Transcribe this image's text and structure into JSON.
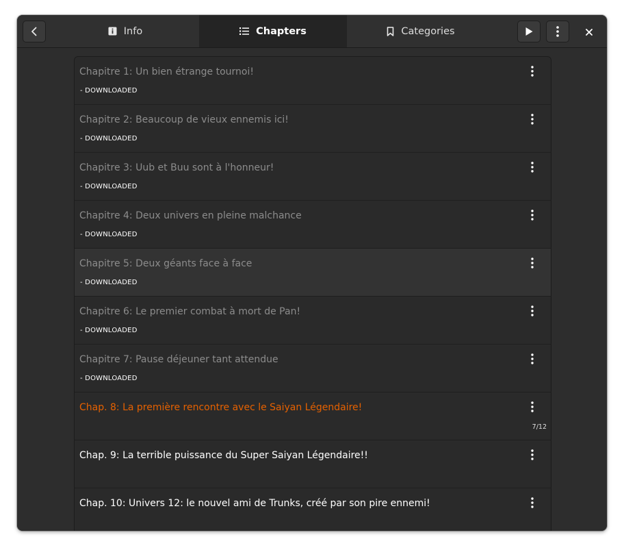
{
  "header": {
    "tabs": [
      {
        "label": "Info",
        "icon": "info-icon",
        "active": false
      },
      {
        "label": "Chapters",
        "icon": "list-icon",
        "active": true
      },
      {
        "label": "Categories",
        "icon": "bookmark-icon",
        "active": false
      }
    ],
    "buttons": [
      "back-arrow-icon",
      "play-icon",
      "kebab-menu-icon",
      "close-icon"
    ]
  },
  "colors": {
    "window_bg": "#2d2d2d",
    "list_bg": "#2a2a2a",
    "read_title": "#8c8c8c",
    "unread_title": "#ffffff",
    "in_progress_title": "#e66100"
  },
  "chapters": [
    {
      "title": "Chapitre 1: Un bien étrange tournoi!",
      "status": "- DOWNLOADED",
      "progress": "",
      "state": "read"
    },
    {
      "title": "Chapitre 2: Beaucoup de vieux ennemis ici!",
      "status": "- DOWNLOADED",
      "progress": "",
      "state": "read"
    },
    {
      "title": "Chapitre 3: Uub et Buu sont à l'honneur!",
      "status": "- DOWNLOADED",
      "progress": "",
      "state": "read"
    },
    {
      "title": "Chapitre 4: Deux univers en pleine malchance",
      "status": "- DOWNLOADED",
      "progress": "",
      "state": "read"
    },
    {
      "title": "Chapitre 5: Deux géants face à face",
      "status": "- DOWNLOADED",
      "progress": "",
      "state": "read"
    },
    {
      "title": "Chapitre 6: Le premier combat à mort de Pan!",
      "status": "- DOWNLOADED",
      "progress": "",
      "state": "read"
    },
    {
      "title": "Chapitre 7: Pause déjeuner tant attendue",
      "status": "- DOWNLOADED",
      "progress": "",
      "state": "read"
    },
    {
      "title": "Chap. 8: La première rencontre avec le Saiyan Légendaire!",
      "status": "",
      "progress": "7/12",
      "state": "reading"
    },
    {
      "title": "Chap. 9: La terrible puissance du Super Saiyan Légendaire!!",
      "status": "",
      "progress": "",
      "state": "unread"
    },
    {
      "title": "Chap. 10: Univers 12: le nouvel ami de Trunks, créé par son pire ennemi!",
      "status": "",
      "progress": "",
      "state": "unread"
    }
  ]
}
